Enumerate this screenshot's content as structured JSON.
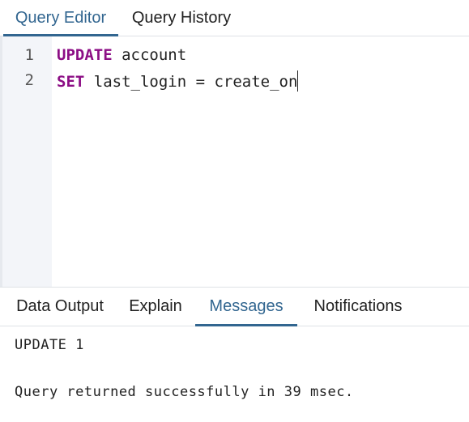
{
  "top_tabs": {
    "query_editor": "Query Editor",
    "query_history": "Query History",
    "active": "Query Editor"
  },
  "editor": {
    "lines": [
      {
        "number": "1",
        "keyword": "UPDATE",
        "rest": " account"
      },
      {
        "number": "2",
        "keyword": "SET",
        "rest": " last_login = create_on"
      }
    ]
  },
  "bottom_tabs": {
    "data_output": "Data Output",
    "explain": "Explain",
    "messages": "Messages",
    "notifications": "Notifications",
    "active": "Messages"
  },
  "messages": {
    "line1": "UPDATE 1",
    "line2": "Query returned successfully in 39 msec."
  },
  "colors": {
    "accent": "#326690",
    "keyword": "#8c0e85",
    "gutter_bg": "#f3f5f9"
  }
}
